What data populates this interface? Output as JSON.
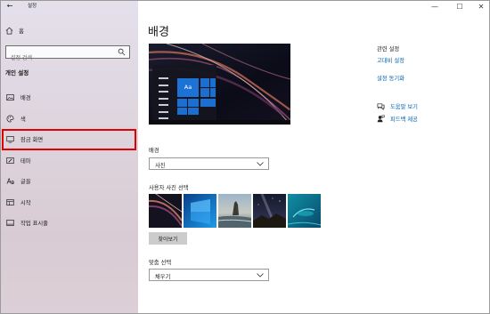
{
  "window": {
    "title": "설정",
    "back_icon": "back-arrow-icon",
    "controls": {
      "minimize": "—",
      "maximize": "☐",
      "close": "✕"
    }
  },
  "sidebar": {
    "home_label": "홈",
    "search_placeholder": "설정 검색",
    "section_title": "개인 설정",
    "items": [
      {
        "label": "배경",
        "icon": "picture-icon"
      },
      {
        "label": "색",
        "icon": "palette-icon"
      },
      {
        "label": "잠금 화면",
        "icon": "lock-screen-icon",
        "active": true
      },
      {
        "label": "테마",
        "icon": "theme-brush-icon"
      },
      {
        "label": "글꼴",
        "icon": "font-icon"
      },
      {
        "label": "시작",
        "icon": "start-menu-icon"
      },
      {
        "label": "작업 표시줄",
        "icon": "taskbar-icon"
      }
    ]
  },
  "main": {
    "title": "배경",
    "preview_tile_label": "Aa",
    "background_label": "배경",
    "background_value": "사진",
    "choose_photo_label": "사용자 사진 선택",
    "browse_label": "찾아보기",
    "fit_label": "맞춤 선택",
    "fit_value": "채우기"
  },
  "related": {
    "title": "관련 설정",
    "links": [
      "고대비 설정",
      "설정 동기화"
    ],
    "help_label": "도움말 보기",
    "feedback_label": "피드백 제공"
  },
  "colors": {
    "link": "#0063b1",
    "highlight": "#e00000",
    "tile": "#1a6fd0"
  }
}
